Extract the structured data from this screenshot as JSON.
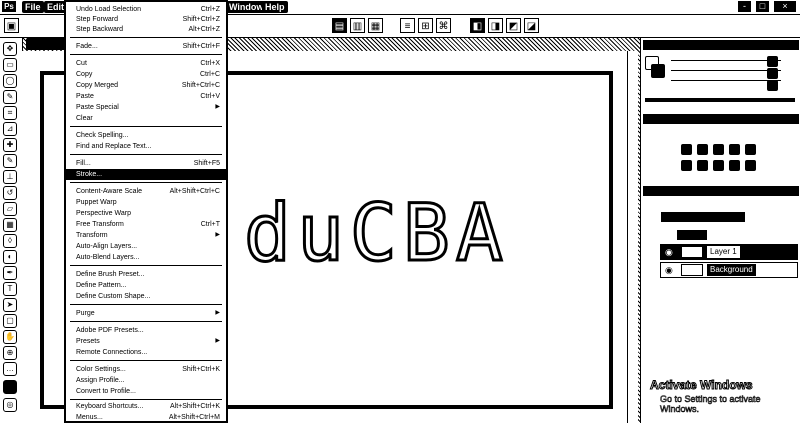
{
  "menubar": {
    "logo": "Ps",
    "items": [
      "File",
      "Edit",
      "Window",
      "Help"
    ],
    "window_buttons": [
      "-",
      "□",
      "×"
    ]
  },
  "canvas": {
    "text": "duCBA"
  },
  "watermark": {
    "line1": "Activate Windows",
    "line2": "Go to Settings to activate Windows."
  },
  "layers": [
    {
      "name": "Layer 1",
      "selected": true
    },
    {
      "name": "Background",
      "selected": false
    }
  ],
  "edit_menu": {
    "items": [
      {
        "label": "Undo Load Selection",
        "shortcut": "Ctrl+Z"
      },
      {
        "label": "Step Forward",
        "shortcut": "Shift+Ctrl+Z"
      },
      {
        "label": "Step Backward",
        "shortcut": "Alt+Ctrl+Z"
      },
      {
        "label": "Fade...",
        "shortcut": "Shift+Ctrl+F"
      },
      {
        "label": "Cut",
        "shortcut": "Ctrl+X"
      },
      {
        "label": "Copy",
        "shortcut": "Ctrl+C"
      },
      {
        "label": "Copy Merged",
        "shortcut": "Shift+Ctrl+C"
      },
      {
        "label": "Paste",
        "shortcut": "Ctrl+V"
      },
      {
        "label": "Paste Special",
        "shortcut": ""
      },
      {
        "label": "Clear",
        "shortcut": ""
      },
      {
        "label": "Check Spelling...",
        "shortcut": ""
      },
      {
        "label": "Find and Replace Text...",
        "shortcut": ""
      },
      {
        "label": "Fill...",
        "shortcut": "Shift+F5"
      },
      {
        "label": "Stroke...",
        "shortcut": ""
      },
      {
        "label": "Content-Aware Scale",
        "shortcut": "Alt+Shift+Ctrl+C"
      },
      {
        "label": "Puppet Warp",
        "shortcut": ""
      },
      {
        "label": "Perspective Warp",
        "shortcut": ""
      },
      {
        "label": "Free Transform",
        "shortcut": "Ctrl+T"
      },
      {
        "label": "Transform",
        "shortcut": ""
      },
      {
        "label": "Auto-Align Layers...",
        "shortcut": ""
      },
      {
        "label": "Auto-Blend Layers...",
        "shortcut": ""
      },
      {
        "label": "Define Brush Preset...",
        "shortcut": ""
      },
      {
        "label": "Define Pattern...",
        "shortcut": ""
      },
      {
        "label": "Define Custom Shape...",
        "shortcut": ""
      },
      {
        "label": "Purge",
        "shortcut": ""
      },
      {
        "label": "Adobe PDF Presets...",
        "shortcut": ""
      },
      {
        "label": "Presets",
        "shortcut": ""
      },
      {
        "label": "Remote Connections...",
        "shortcut": ""
      },
      {
        "label": "Color Settings...",
        "shortcut": "Shift+Ctrl+K"
      },
      {
        "label": "Assign Profile...",
        "shortcut": ""
      },
      {
        "label": "Convert to Profile...",
        "shortcut": ""
      },
      {
        "label": "Keyboard Shortcuts...",
        "shortcut": "Alt+Shift+Ctrl+K"
      },
      {
        "label": "Menus...",
        "shortcut": "Alt+Shift+Ctrl+M"
      }
    ]
  }
}
